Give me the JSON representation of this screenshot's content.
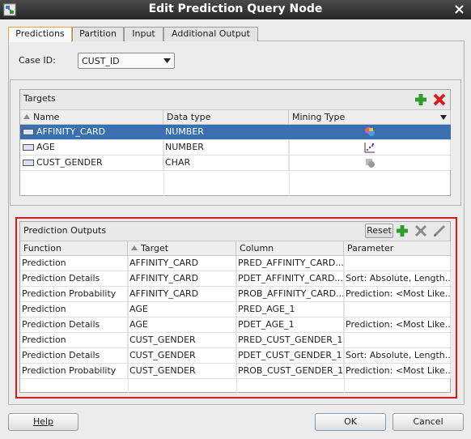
{
  "window": {
    "title": "Edit Prediction Query Node"
  },
  "tabs": [
    {
      "label": "Predictions",
      "active": true
    },
    {
      "label": "Partition",
      "active": false
    },
    {
      "label": "Input",
      "active": false
    },
    {
      "label": "Additional Output",
      "active": false
    }
  ],
  "case_id": {
    "label": "Case ID:",
    "value": "CUST_ID"
  },
  "targets": {
    "title": "Targets",
    "columns": [
      "Name",
      "Data type",
      "Mining Type"
    ],
    "rows": [
      {
        "name": "AFFINITY_CARD",
        "data_type": "NUMBER",
        "mining_icon": "classification-icon",
        "selected": true
      },
      {
        "name": "AGE",
        "data_type": "NUMBER",
        "mining_icon": "regression-icon",
        "selected": false
      },
      {
        "name": "CUST_GENDER",
        "data_type": "CHAR",
        "mining_icon": "categorical-icon",
        "selected": false
      }
    ]
  },
  "prediction_outputs": {
    "title": "Prediction Outputs",
    "reset_label": "Reset",
    "columns": [
      "Function",
      "Target",
      "Column",
      "Parameter"
    ],
    "rows": [
      [
        "Prediction",
        "AFFINITY_CARD",
        "PRED_AFFINITY_CARD...",
        ""
      ],
      [
        "Prediction Details",
        "AFFINITY_CARD",
        "PDET_AFFINITY_CARD...",
        "Sort: Absolute, Length..."
      ],
      [
        "Prediction Probability",
        "AFFINITY_CARD",
        "PROB_AFFINITY_CARD...",
        "Prediction: <Most Like..."
      ],
      [
        "Prediction",
        "AGE",
        "PRED_AGE_1",
        ""
      ],
      [
        "Prediction Details",
        "AGE",
        "PDET_AGE_1",
        "Prediction: <Most Like..."
      ],
      [
        "Prediction",
        "CUST_GENDER",
        "PRED_CUST_GENDER_1",
        ""
      ],
      [
        "Prediction Details",
        "CUST_GENDER",
        "PDET_CUST_GENDER_1",
        "Sort: Absolute, Length..."
      ],
      [
        "Prediction Probability",
        "CUST_GENDER",
        "PROB_CUST_GENDER_1",
        "Prediction: <Most Like..."
      ]
    ]
  },
  "buttons": {
    "help": "Help",
    "ok": "OK",
    "cancel": "Cancel"
  },
  "colors": {
    "selection": "#3a6fb0",
    "highlight_border": "#d31c1c",
    "add": "#2f9e2f",
    "delete": "#d42020"
  }
}
